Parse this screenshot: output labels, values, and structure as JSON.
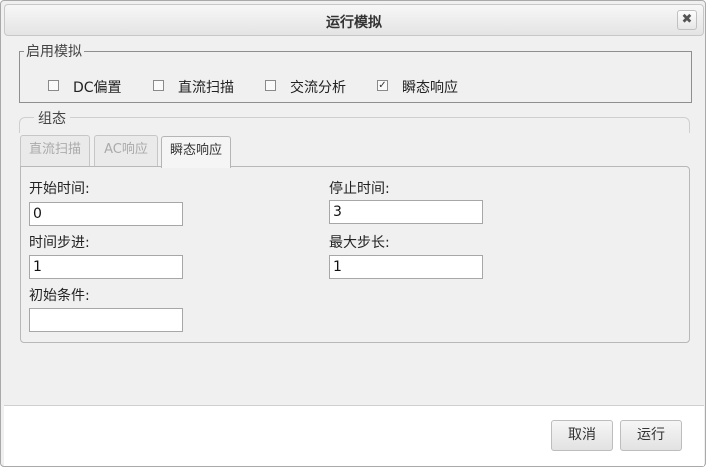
{
  "dialog": {
    "title": "运行模拟",
    "close_glyph": "✖"
  },
  "simulation": {
    "legend": "启用模拟",
    "options": [
      {
        "label": "DC偏置",
        "checked": false
      },
      {
        "label": "直流扫描",
        "checked": false
      },
      {
        "label": "交流分析",
        "checked": false
      },
      {
        "label": "瞬态响应",
        "checked": true
      }
    ]
  },
  "config": {
    "legend": "组态",
    "tabs": [
      {
        "label": "直流扫描",
        "active": false
      },
      {
        "label": "AC响应",
        "active": false
      },
      {
        "label": "瞬态响应",
        "active": true
      }
    ],
    "fields": {
      "start_time": {
        "label": "开始时间:",
        "value": "0"
      },
      "stop_time": {
        "label": "停止时间:",
        "value": "3"
      },
      "time_step": {
        "label": "时间步进:",
        "value": "1"
      },
      "max_step": {
        "label": "最大步长:",
        "value": "1"
      },
      "initial_conditions": {
        "label": "初始条件:",
        "value": ""
      }
    }
  },
  "footer": {
    "cancel_label": "取消",
    "run_label": "运行"
  }
}
